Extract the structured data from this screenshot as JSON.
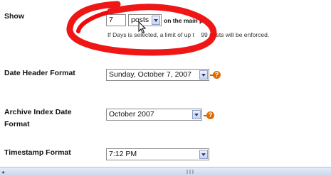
{
  "show": {
    "label": "Show",
    "count_value": "7",
    "unit_value": "posts",
    "suffix": "on the main p",
    "note": "If Days is selected, a limit of up t    99 posts will be enforced."
  },
  "date_header": {
    "label": "Date Header Format",
    "value": "Sunday, October 7, 2007",
    "help": "?"
  },
  "archive_index": {
    "label_line1": "Archive Index Date",
    "label_line2": "Format",
    "value": "October 2007",
    "help": "?"
  },
  "timestamp": {
    "label": "Timestamp Format",
    "value": "7:12 PM"
  },
  "annotation": {
    "color": "#ee0a0a"
  },
  "scrollbar": {
    "left_arrow": "◂"
  }
}
